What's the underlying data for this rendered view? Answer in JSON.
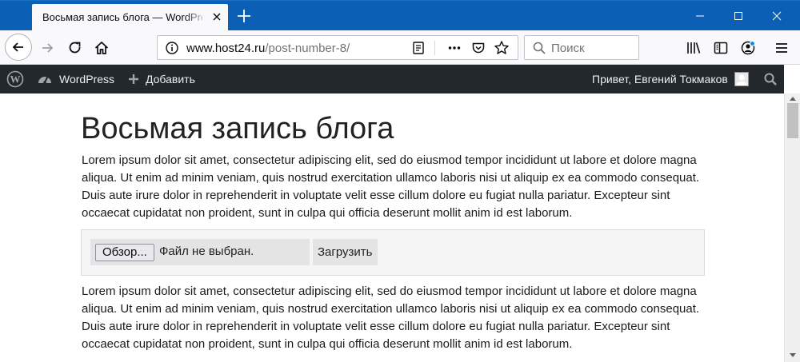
{
  "browser": {
    "tab_title": "Восьмая запись блога — WordPress",
    "url_scheme_host": "www.host24.ru",
    "url_path": "/post-number-8/",
    "search_placeholder": "Поиск",
    "accent_color": "#0b5fb4"
  },
  "icons": [
    "close-icon",
    "plus-icon",
    "minimize-icon",
    "maximize-icon",
    "back-arrow-icon",
    "forward-arrow-icon",
    "reload-icon",
    "home-icon",
    "info-icon",
    "reader-view-icon",
    "more-icon",
    "pocket-icon",
    "star-icon",
    "search-icon",
    "library-icon",
    "sidebar-icon",
    "account-icon",
    "menu-icon",
    "wordpress-logo-icon",
    "dashboard-icon",
    "avatar"
  ],
  "adminbar": {
    "site_name": "WordPress",
    "add_new": "Добавить",
    "greeting": "Привет, Евгений Токмаков",
    "background_color": "#23282d"
  },
  "post": {
    "title": "Восьмая запись блога",
    "paragraph_1": "Lorem ipsum dolor sit amet, consectetur adipiscing elit, sed do eiusmod tempor incididunt ut labore et dolore magna aliqua. Ut enim ad minim veniam, quis nostrud exercitation ullamco laboris nisi ut aliquip ex ea commodo consequat. Duis aute irure dolor in reprehenderit in voluptate velit esse cillum dolore eu fugiat nulla pariatur. Excepteur sint occaecat cupidatat non proident, sunt in culpa qui officia deserunt mollit anim id est laborum.",
    "paragraph_2": "Lorem ipsum dolor sit amet, consectetur adipiscing elit, sed do eiusmod tempor incididunt ut labore et dolore magna aliqua. Ut enim ad minim veniam, quis nostrud exercitation ullamco laboris nisi ut aliquip ex ea commodo consequat. Duis aute irure dolor in reprehenderit in voluptate velit esse cillum dolore eu fugiat nulla pariatur. Excepteur sint occaecat cupidatat non proident, sunt in culpa qui officia deserunt mollit anim id est laborum."
  },
  "upload": {
    "browse_label": "Обзор...",
    "no_file_label": "Файл не выбран.",
    "submit_label": "Загрузить"
  }
}
